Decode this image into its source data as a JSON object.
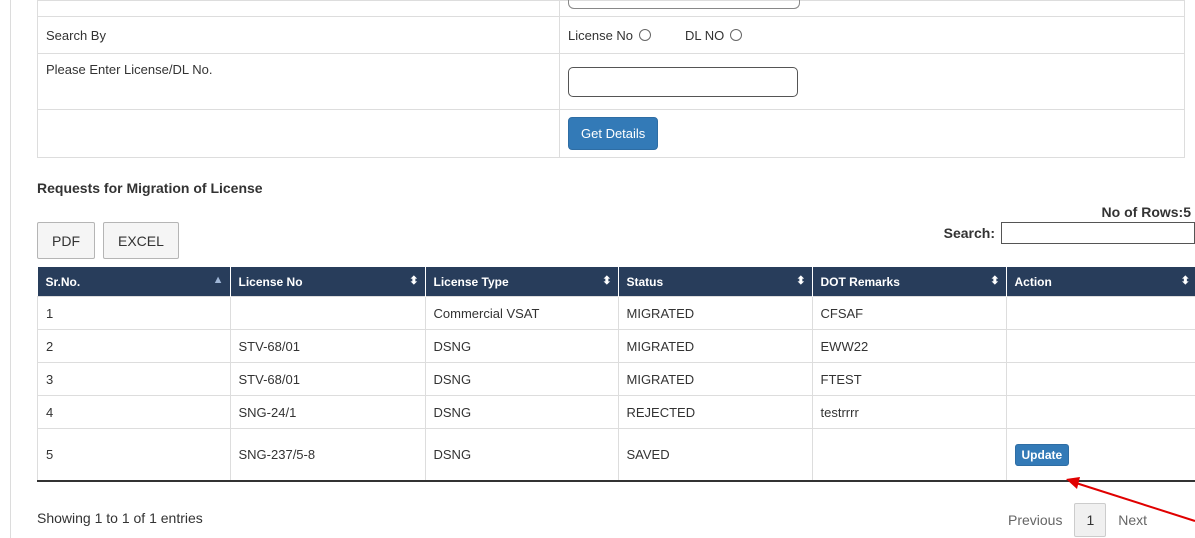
{
  "form": {
    "search_by_label": "Search By",
    "radio_license_label": "License No",
    "radio_dl_label": "DL NO",
    "enter_label": "Please Enter License/DL No.",
    "license_input_value": "",
    "get_details_label": "Get Details"
  },
  "section": {
    "title": "Requests for Migration of License",
    "rows_count": "No of Rows:5"
  },
  "toolbar": {
    "pdf_label": "PDF",
    "excel_label": "EXCEL",
    "search_label": "Search:",
    "search_value": ""
  },
  "table": {
    "headers": [
      "Sr.No.",
      "License No",
      "License Type",
      "Status",
      "DOT Remarks",
      "Action"
    ],
    "rows": [
      {
        "sr": "1",
        "license_no": "",
        "license_type": "Commercial VSAT",
        "status": "MIGRATED",
        "remarks": "CFSAF",
        "action": ""
      },
      {
        "sr": "2",
        "license_no": "STV-68/01",
        "license_type": "DSNG",
        "status": "MIGRATED",
        "remarks": "EWW22",
        "action": ""
      },
      {
        "sr": "3",
        "license_no": "STV-68/01",
        "license_type": "DSNG",
        "status": "MIGRATED",
        "remarks": "FTEST",
        "action": ""
      },
      {
        "sr": "4",
        "license_no": "SNG-24/1",
        "license_type": "DSNG",
        "status": "REJECTED",
        "remarks": "testrrrr",
        "action": ""
      },
      {
        "sr": "5",
        "license_no": "SNG-237/5-8",
        "license_type": "DSNG",
        "status": "SAVED",
        "remarks": "",
        "action": "Update"
      }
    ]
  },
  "footer": {
    "info": "Showing 1 to 1 of 1 entries",
    "previous_label": "Previous",
    "page_number": "1",
    "next_label": "Next"
  },
  "colors": {
    "header_bg": "#283d5b",
    "primary_button": "#337ab7",
    "annotation_arrow": "#e00000"
  }
}
